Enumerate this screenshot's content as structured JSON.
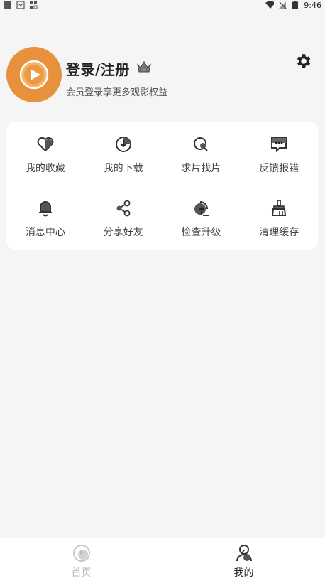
{
  "status_bar": {
    "time": "9:46"
  },
  "profile": {
    "title": "登录/注册",
    "subtitle": "会员登录享更多观影权益"
  },
  "menu": {
    "items": [
      {
        "label": "我的收藏",
        "icon": "heart-icon"
      },
      {
        "label": "我的下载",
        "icon": "download-icon"
      },
      {
        "label": "求片找片",
        "icon": "search-movie-icon"
      },
      {
        "label": "反馈报错",
        "icon": "feedback-icon"
      },
      {
        "label": "消息中心",
        "icon": "bell-icon"
      },
      {
        "label": "分享好友",
        "icon": "share-icon"
      },
      {
        "label": "检查升级",
        "icon": "upgrade-icon"
      },
      {
        "label": "清理缓存",
        "icon": "broom-icon"
      }
    ]
  },
  "bottom_nav": {
    "home": "首页",
    "mine": "我的"
  },
  "colors": {
    "accent": "#e8913d",
    "background": "#f5f5f5",
    "card": "#ffffff",
    "inactive": "#b5b5b5"
  }
}
